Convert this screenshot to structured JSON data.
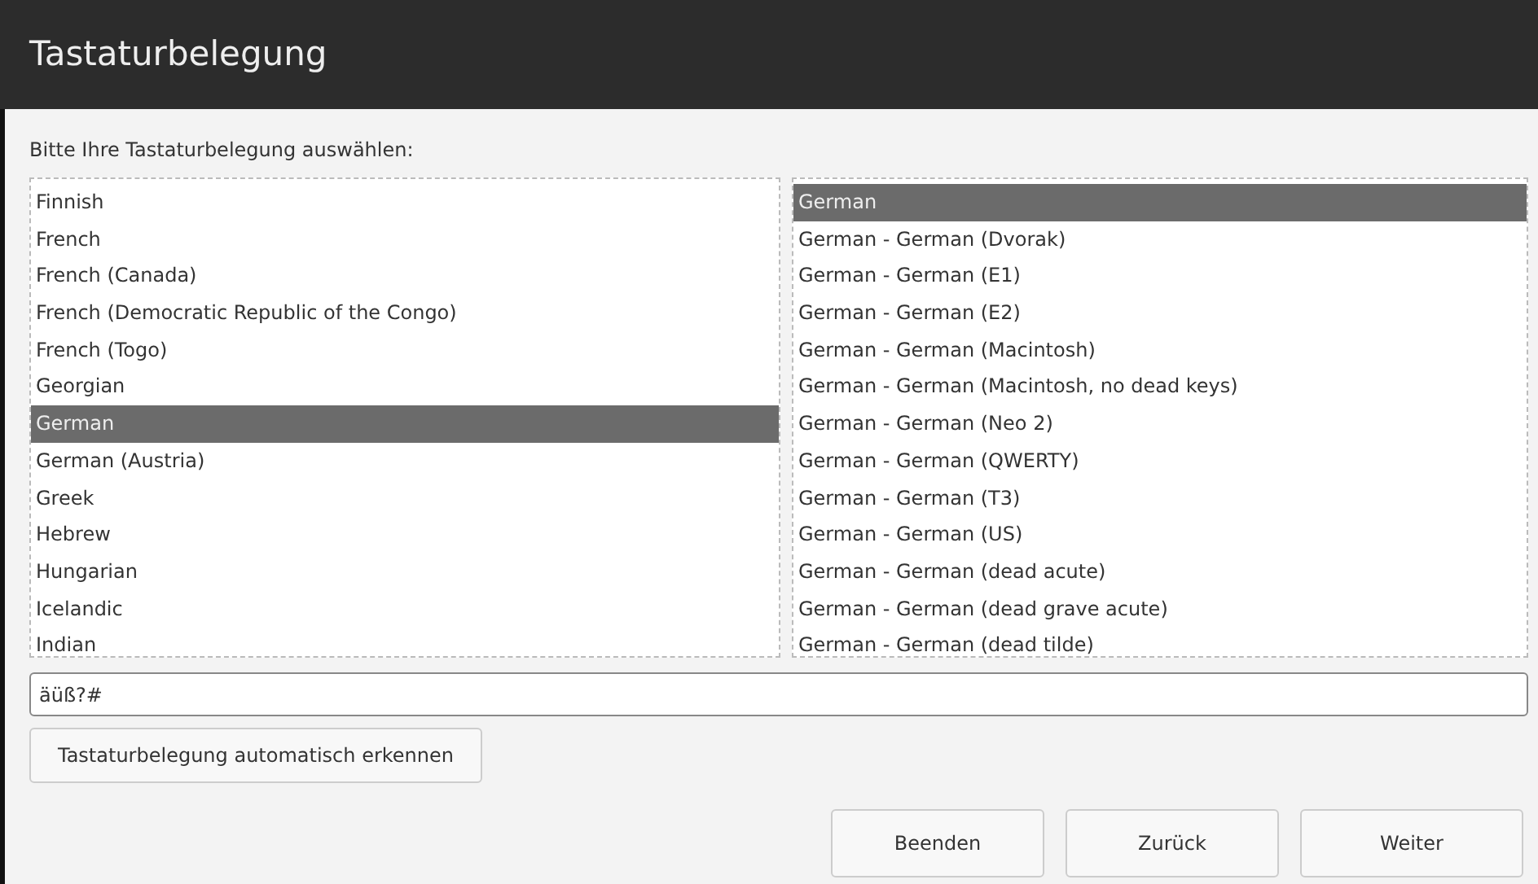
{
  "window": {
    "title": "Tastaturbelegung"
  },
  "prompt": "Bitte Ihre Tastaturbelegung auswählen:",
  "layouts": [
    {
      "label": "Finnish",
      "selected": false
    },
    {
      "label": "French",
      "selected": false
    },
    {
      "label": "French (Canada)",
      "selected": false
    },
    {
      "label": "French (Democratic Republic of the Congo)",
      "selected": false
    },
    {
      "label": "French (Togo)",
      "selected": false
    },
    {
      "label": "Georgian",
      "selected": false
    },
    {
      "label": "German",
      "selected": true
    },
    {
      "label": "German (Austria)",
      "selected": false
    },
    {
      "label": "Greek",
      "selected": false
    },
    {
      "label": "Hebrew",
      "selected": false
    },
    {
      "label": "Hungarian",
      "selected": false
    },
    {
      "label": "Icelandic",
      "selected": false
    },
    {
      "label": "Indian",
      "selected": false
    }
  ],
  "variants": [
    {
      "label": "German",
      "selected": true
    },
    {
      "label": "German - German (Dvorak)",
      "selected": false
    },
    {
      "label": "German - German (E1)",
      "selected": false
    },
    {
      "label": "German - German (E2)",
      "selected": false
    },
    {
      "label": "German - German (Macintosh)",
      "selected": false
    },
    {
      "label": "German - German (Macintosh, no dead keys)",
      "selected": false
    },
    {
      "label": "German - German (Neo 2)",
      "selected": false
    },
    {
      "label": "German - German (QWERTY)",
      "selected": false
    },
    {
      "label": "German - German (T3)",
      "selected": false
    },
    {
      "label": "German - German (US)",
      "selected": false
    },
    {
      "label": "German - German (dead acute)",
      "selected": false
    },
    {
      "label": "German - German (dead grave acute)",
      "selected": false
    },
    {
      "label": "German - German (dead tilde)",
      "selected": false
    }
  ],
  "test_field": {
    "value": "äüß?#"
  },
  "detect_button": "Tastaturbelegung automatisch erkennen",
  "buttons": [
    "Beenden",
    "Zurück",
    "Weiter"
  ]
}
